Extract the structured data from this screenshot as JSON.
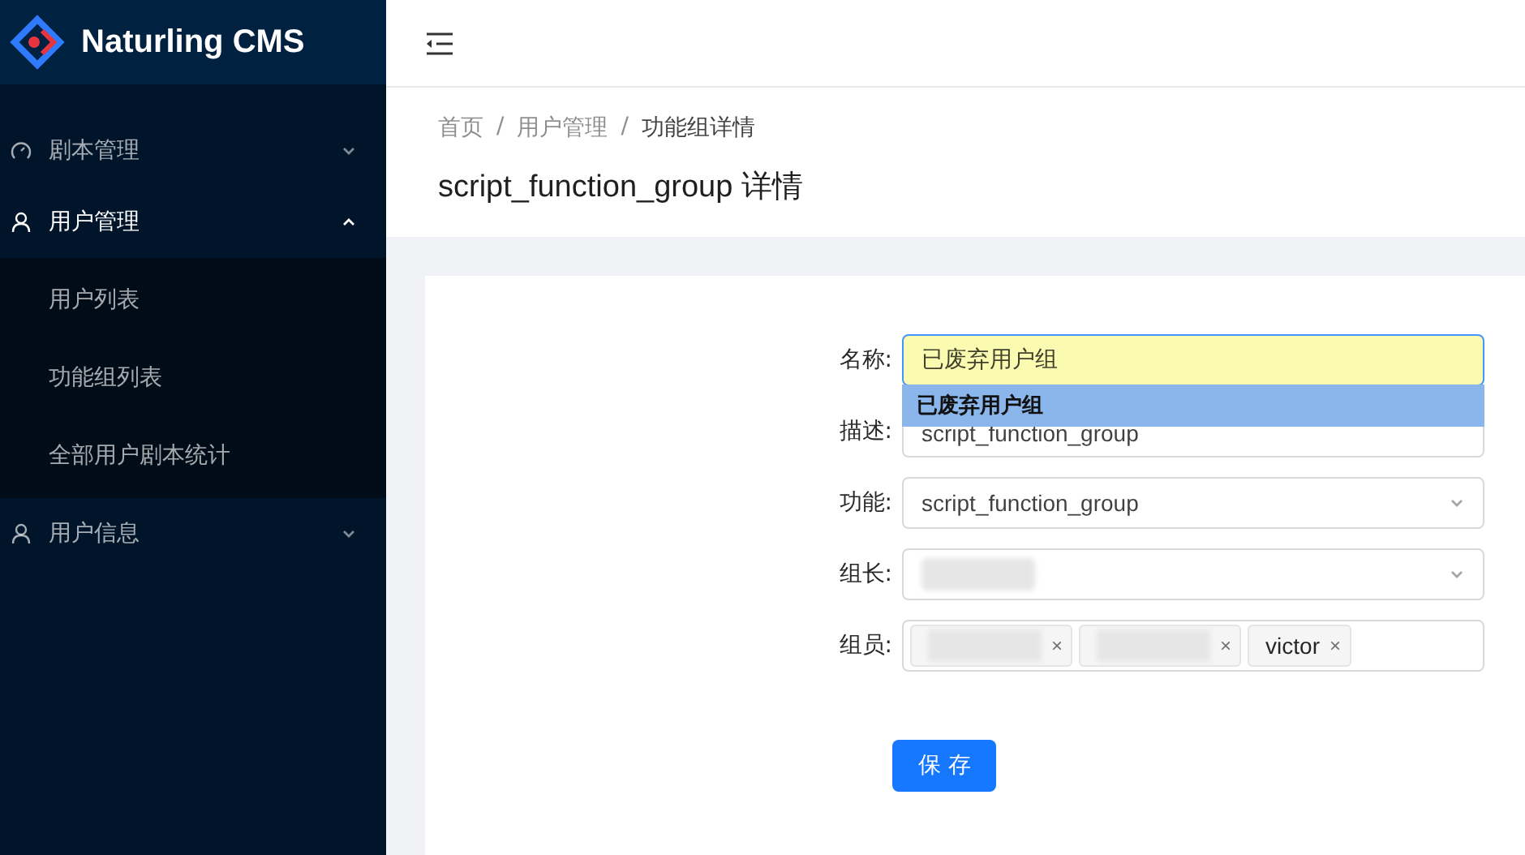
{
  "app": {
    "title": "Naturling CMS"
  },
  "sidebar": {
    "items": [
      {
        "label": "剧本管理",
        "expanded": false
      },
      {
        "label": "用户管理",
        "expanded": true,
        "children": [
          {
            "label": "用户列表",
            "selected": false
          },
          {
            "label": "功能组列表",
            "selected": false
          },
          {
            "label": "全部用户剧本统计",
            "selected": false
          }
        ]
      },
      {
        "label": "用户信息",
        "expanded": false
      }
    ]
  },
  "breadcrumb": {
    "items": [
      "首页",
      "用户管理",
      "功能组详情"
    ],
    "separators": [
      "/",
      "/"
    ]
  },
  "page_title": "script_function_group 详情",
  "form": {
    "fields": [
      {
        "label": "名称:",
        "kind": "input",
        "value": "已废弃用户组",
        "autofilled": true,
        "suggestion": "已废弃用户组"
      },
      {
        "label": "描述:",
        "kind": "input",
        "value": "script_function_group",
        "autofilled": false
      },
      {
        "label": "功能:",
        "kind": "select",
        "value": "script_function_group"
      },
      {
        "label": "组长:",
        "kind": "select",
        "redacted": true
      },
      {
        "label": "组员:",
        "kind": "tags",
        "tags": [
          {
            "redacted": true,
            "remove": "×"
          },
          {
            "redacted": true,
            "remove": "×"
          },
          {
            "text": "victor",
            "remove": "×"
          }
        ]
      }
    ],
    "submit": "保 存"
  }
}
